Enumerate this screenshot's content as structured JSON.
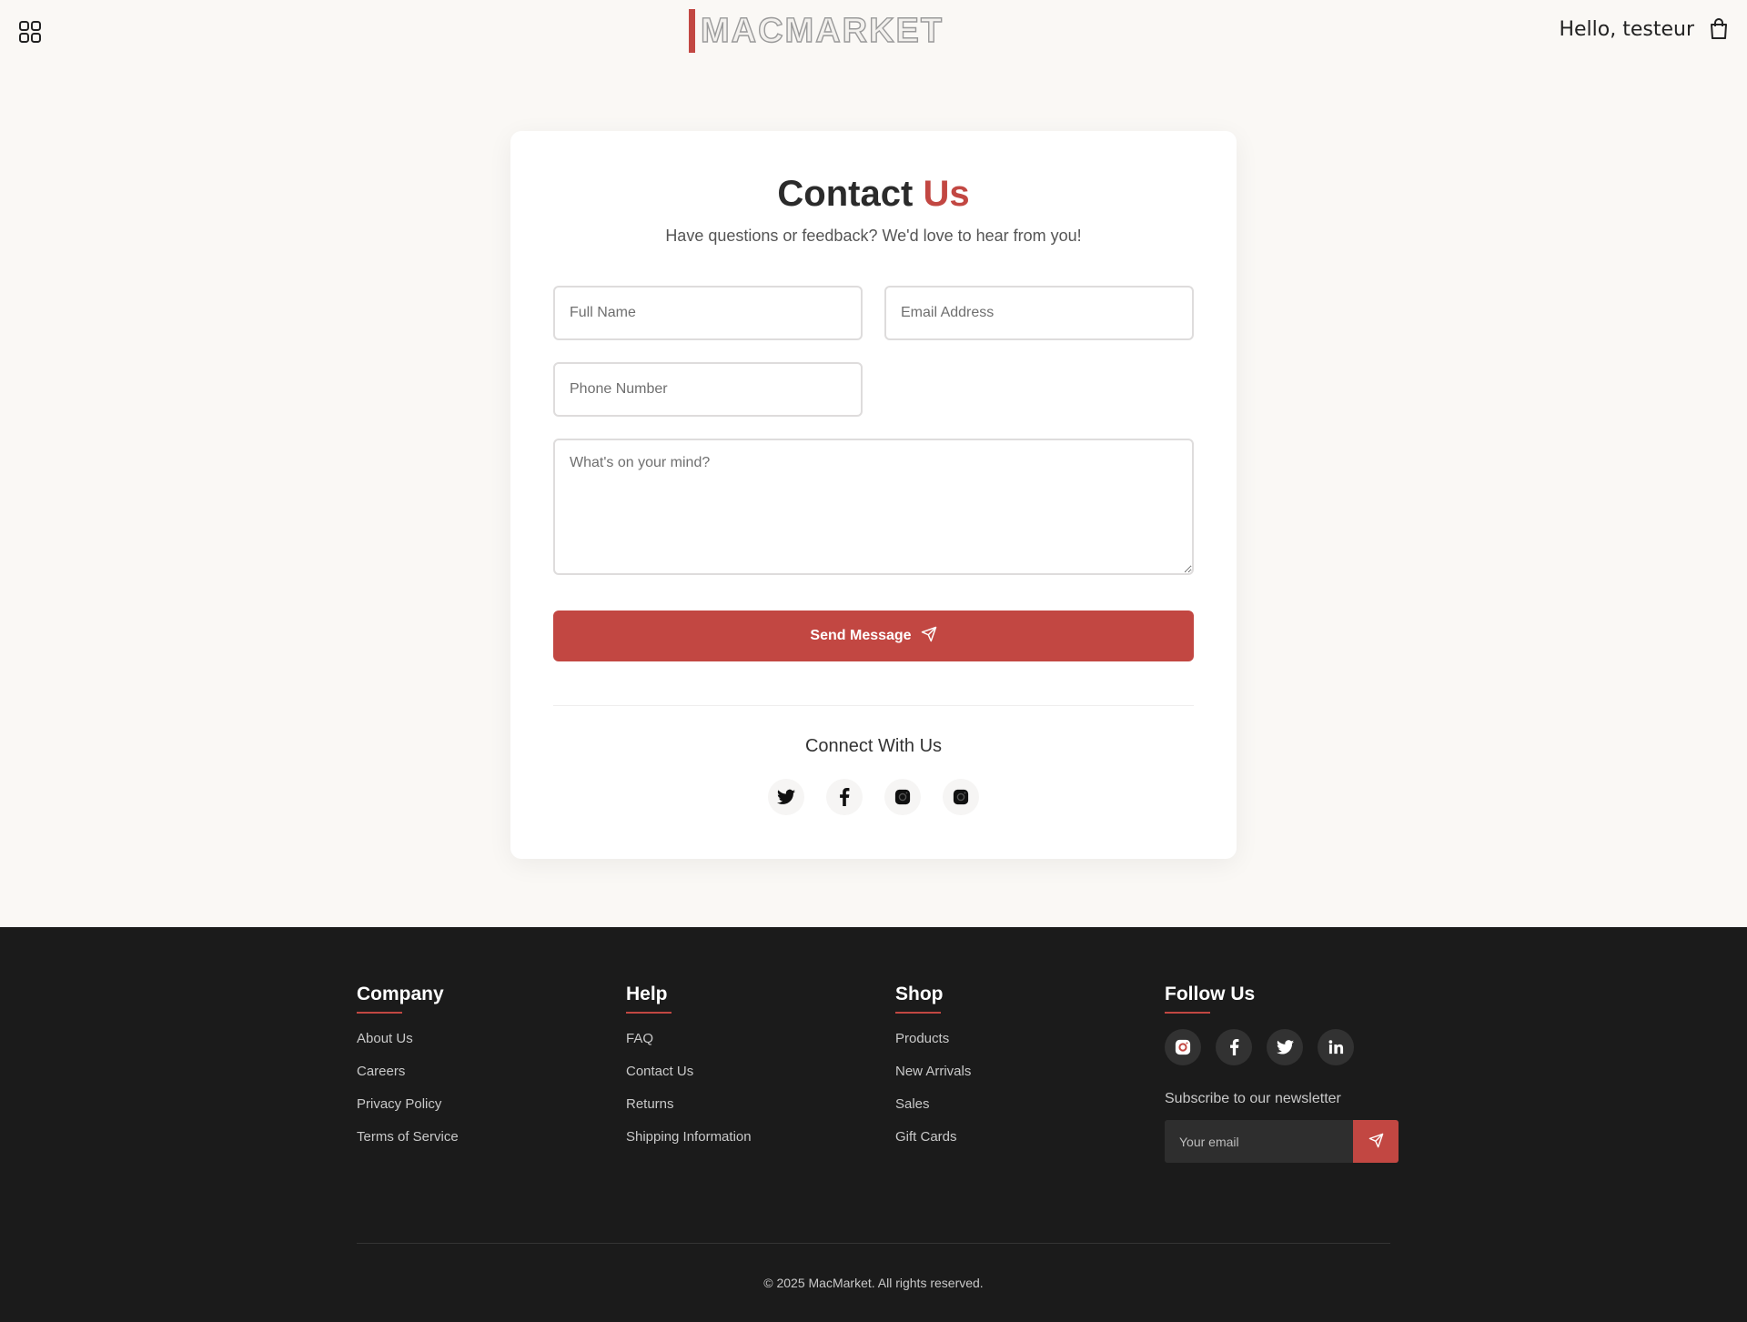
{
  "header": {
    "logo_text": "MACMARKET",
    "greeting": "Hello, testeur",
    "menu_icon": "grid-menu-icon",
    "cart_icon": "shopping-bag-icon"
  },
  "contact": {
    "title_main": "Contact",
    "title_accent": "Us",
    "subtitle": "Have questions or feedback? We'd love to hear from you!",
    "fields": {
      "full_name": "Full Name",
      "email": "Email Address",
      "phone": "Phone Number",
      "message": "What's on your mind?"
    },
    "send_label": "Send Message",
    "connect_title": "Connect With Us",
    "socials": [
      "twitter-icon",
      "facebook-icon",
      "instagram-icon",
      "instagram-icon"
    ]
  },
  "footer": {
    "company": {
      "title": "Company",
      "links": [
        "About Us",
        "Careers",
        "Privacy Policy",
        "Terms of Service"
      ]
    },
    "help": {
      "title": "Help",
      "links": [
        "FAQ",
        "Contact Us",
        "Returns",
        "Shipping Information"
      ]
    },
    "shop": {
      "title": "Shop",
      "links": [
        "Products",
        "New Arrivals",
        "Sales",
        "Gift Cards"
      ]
    },
    "follow": {
      "title": "Follow Us",
      "socials": [
        "instagram-icon",
        "facebook-icon",
        "twitter-icon",
        "linkedin-icon"
      ],
      "newsletter_label": "Subscribe to our newsletter",
      "email_placeholder": "Your email"
    },
    "copyright": "© 2025 MacMarket. All rights reserved."
  },
  "colors": {
    "accent": "#c24742",
    "page_bg": "#faf8f5",
    "footer_bg": "#1b1b1b"
  }
}
